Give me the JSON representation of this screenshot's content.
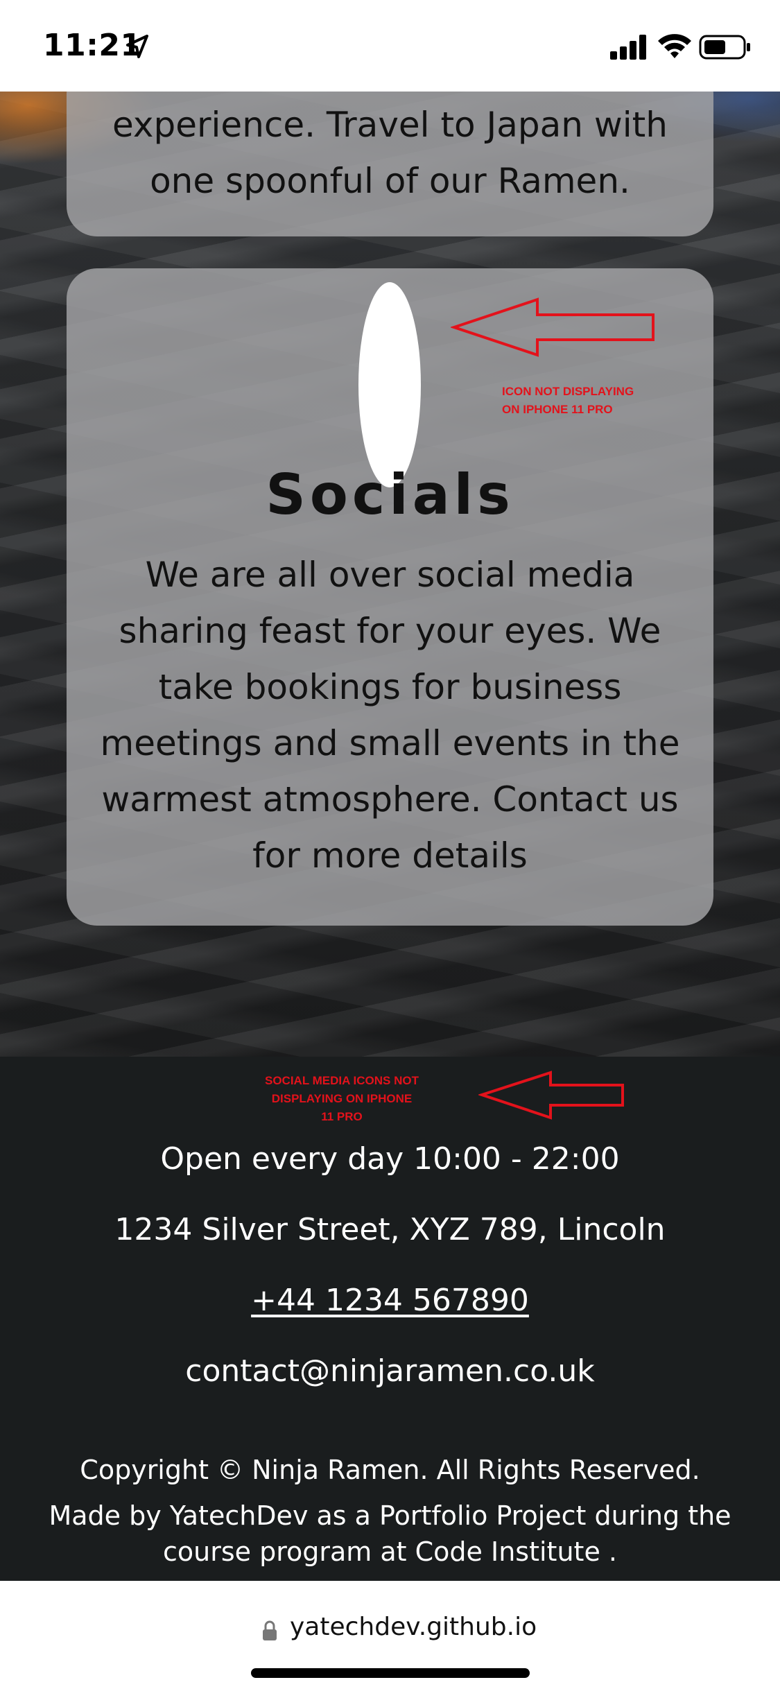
{
  "status_bar": {
    "time": "11:21",
    "icons": [
      "location-arrow-icon",
      "cellular-signal-icon",
      "wifi-icon",
      "battery-icon"
    ]
  },
  "cards": {
    "intro_text": "experience. Travel to Japan with one spoonful of our Ramen.",
    "socials": {
      "title": "Socials",
      "text": "We are all over social media sharing feast for your eyes. We take bookings for business meetings and small events in the warmest atmosphere. Contact us for more details",
      "icon": "social-media-icon"
    }
  },
  "annotations": {
    "icon_note_line1": "ICON NOT DISPLAYING",
    "icon_note_line2": "ON IPHONE 11 PRO",
    "social_note_line1": "SOCIAL MEDIA ICONS NOT",
    "social_note_line2": "DISPLAYING ON IPHONE",
    "social_note_line3": "11 PRO",
    "color": "#e3121b"
  },
  "footer": {
    "hours": "Open every day 10:00 - 22:00",
    "address": "1234 Silver Street, XYZ 789, Lincoln",
    "phone": "+44 1234 567890",
    "email": "contact@ninjaramen.co.uk",
    "copyright": "Copyright © Ninja Ramen. All Rights Reserved.",
    "made_by": "Made by YatechDev as a Portfolio Project during the course program at Code Institute ."
  },
  "browser": {
    "url": "yatechdev.github.io"
  },
  "colors": {
    "footer_bg": "#1a1d1e",
    "card_bg": "#a5a5a7",
    "annotation_red": "#e3121b"
  }
}
